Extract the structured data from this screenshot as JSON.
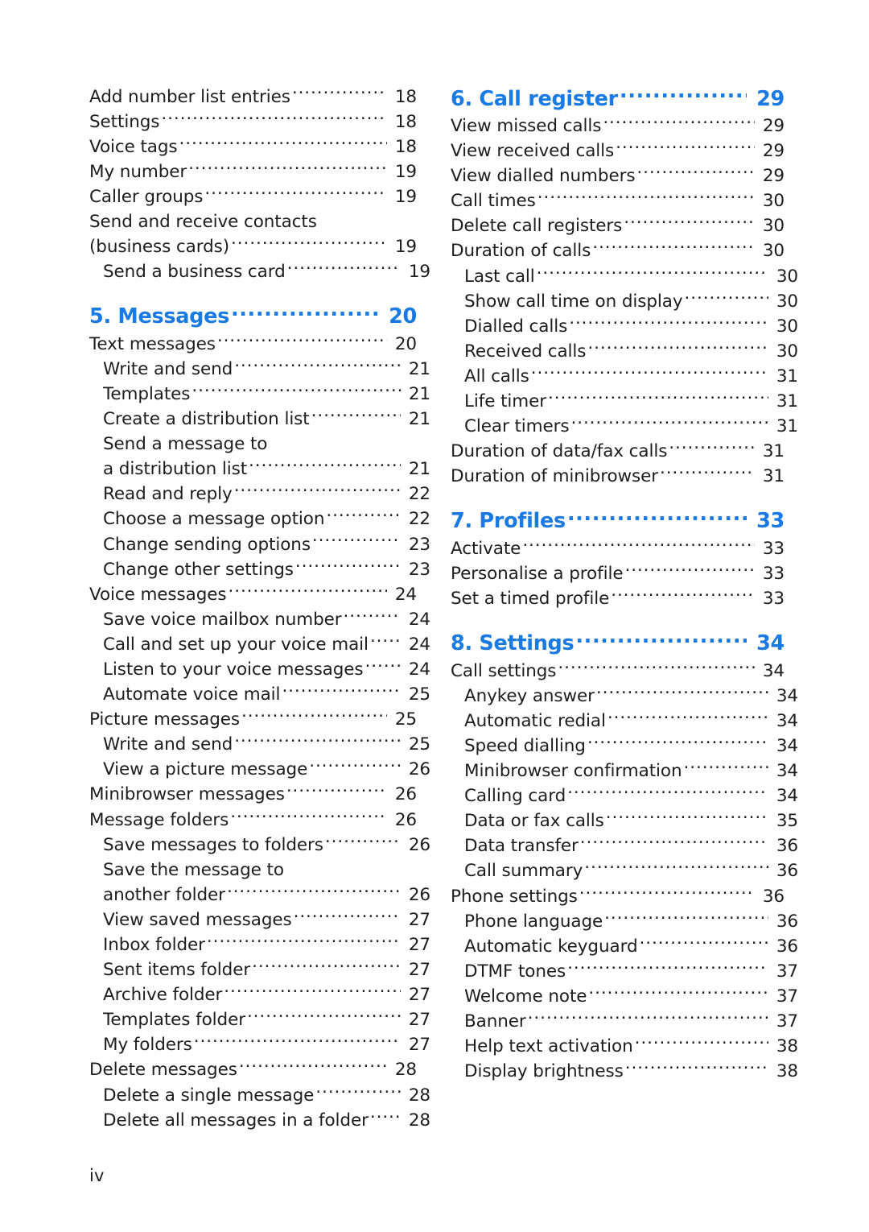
{
  "document": {
    "page_folio": "iv",
    "accent_color": "#1a7ae4",
    "text_color": "#1d1d1b"
  },
  "left_column": [
    {
      "kind": "entry",
      "level": 1,
      "label": "Add number list entries",
      "page": "18"
    },
    {
      "kind": "entry",
      "level": 1,
      "label": "Settings",
      "page": "18"
    },
    {
      "kind": "entry",
      "level": 1,
      "label": "Voice tags",
      "page": "18"
    },
    {
      "kind": "entry",
      "level": 1,
      "label": "My number",
      "page": "19"
    },
    {
      "kind": "entry",
      "level": 1,
      "label": "Caller groups",
      "page": "19"
    },
    {
      "kind": "wrap",
      "level": 1,
      "label": "Send and receive contacts",
      "page": ""
    },
    {
      "kind": "entry",
      "level": 1,
      "label": "(business cards)",
      "page": "19"
    },
    {
      "kind": "entry",
      "level": 2,
      "label": "Send a business card",
      "page": "19"
    },
    {
      "kind": "section",
      "level": 1,
      "label": "5. Messages",
      "page": "20"
    },
    {
      "kind": "entry",
      "level": 1,
      "label": "Text messages",
      "page": "20"
    },
    {
      "kind": "entry",
      "level": 2,
      "label": "Write and send",
      "page": "21"
    },
    {
      "kind": "entry",
      "level": 2,
      "label": "Templates",
      "page": "21"
    },
    {
      "kind": "entry",
      "level": 2,
      "label": "Create a distribution list",
      "page": "21"
    },
    {
      "kind": "wrap",
      "level": 2,
      "label": "Send a message to",
      "page": ""
    },
    {
      "kind": "entry",
      "level": 2,
      "label": "a distribution list",
      "page": "21"
    },
    {
      "kind": "entry",
      "level": 2,
      "label": "Read and reply",
      "page": "22"
    },
    {
      "kind": "entry",
      "level": 2,
      "label": "Choose a message option",
      "page": "22"
    },
    {
      "kind": "entry",
      "level": 2,
      "label": "Change sending options",
      "page": "23"
    },
    {
      "kind": "entry",
      "level": 2,
      "label": "Change other settings",
      "page": "23"
    },
    {
      "kind": "entry",
      "level": 1,
      "label": "Voice messages",
      "page": "24"
    },
    {
      "kind": "entry",
      "level": 2,
      "label": "Save voice mailbox number",
      "page": "24"
    },
    {
      "kind": "entry",
      "level": 2,
      "label": "Call and set up your voice mail",
      "page": "24"
    },
    {
      "kind": "entry",
      "level": 2,
      "label": "Listen to your voice messages",
      "page": "24"
    },
    {
      "kind": "entry",
      "level": 2,
      "label": "Automate voice mail",
      "page": "25"
    },
    {
      "kind": "entry",
      "level": 1,
      "label": "Picture messages",
      "page": "25"
    },
    {
      "kind": "entry",
      "level": 2,
      "label": "Write and send",
      "page": "25"
    },
    {
      "kind": "entry",
      "level": 2,
      "label": "View a picture message",
      "page": "26"
    },
    {
      "kind": "entry",
      "level": 1,
      "label": "Minibrowser messages",
      "page": "26"
    },
    {
      "kind": "entry",
      "level": 1,
      "label": "Message folders",
      "page": "26"
    },
    {
      "kind": "entry",
      "level": 2,
      "label": "Save messages to folders",
      "page": "26"
    },
    {
      "kind": "wrap",
      "level": 2,
      "label": "Save the message to",
      "page": ""
    },
    {
      "kind": "entry",
      "level": 2,
      "label": "another folder",
      "page": "26"
    },
    {
      "kind": "entry",
      "level": 2,
      "label": "View saved messages",
      "page": "27"
    },
    {
      "kind": "entry",
      "level": 2,
      "label": "Inbox folder",
      "page": "27"
    },
    {
      "kind": "entry",
      "level": 2,
      "label": "Sent items folder",
      "page": "27"
    },
    {
      "kind": "entry",
      "level": 2,
      "label": "Archive folder",
      "page": "27"
    },
    {
      "kind": "entry",
      "level": 2,
      "label": "Templates folder",
      "page": "27"
    },
    {
      "kind": "entry",
      "level": 2,
      "label": "My folders",
      "page": "27"
    },
    {
      "kind": "entry",
      "level": 1,
      "label": "Delete messages",
      "page": "28"
    },
    {
      "kind": "entry",
      "level": 2,
      "label": "Delete a single message",
      "page": "28"
    },
    {
      "kind": "entry",
      "level": 2,
      "label": "Delete all messages in a folder",
      "page": "28"
    }
  ],
  "right_column": [
    {
      "kind": "section",
      "level": 1,
      "label": "6. Call register",
      "page": "29",
      "first": true
    },
    {
      "kind": "entry",
      "level": 1,
      "label": "View missed calls",
      "page": "29"
    },
    {
      "kind": "entry",
      "level": 1,
      "label": "View received calls",
      "page": "29"
    },
    {
      "kind": "entry",
      "level": 1,
      "label": "View dialled numbers",
      "page": "29"
    },
    {
      "kind": "entry",
      "level": 1,
      "label": "Call times",
      "page": "30"
    },
    {
      "kind": "entry",
      "level": 1,
      "label": "Delete call registers",
      "page": "30"
    },
    {
      "kind": "entry",
      "level": 1,
      "label": "Duration of calls",
      "page": "30"
    },
    {
      "kind": "entry",
      "level": 2,
      "label": "Last call",
      "page": "30"
    },
    {
      "kind": "entry",
      "level": 2,
      "label": "Show call time on display",
      "page": "30"
    },
    {
      "kind": "entry",
      "level": 2,
      "label": "Dialled calls",
      "page": "30"
    },
    {
      "kind": "entry",
      "level": 2,
      "label": "Received calls",
      "page": "30"
    },
    {
      "kind": "entry",
      "level": 2,
      "label": "All calls",
      "page": "31"
    },
    {
      "kind": "entry",
      "level": 2,
      "label": "Life timer",
      "page": "31"
    },
    {
      "kind": "entry",
      "level": 2,
      "label": "Clear timers",
      "page": "31"
    },
    {
      "kind": "entry",
      "level": 1,
      "label": "Duration of data/fax calls",
      "page": "31"
    },
    {
      "kind": "entry",
      "level": 1,
      "label": "Duration of minibrowser",
      "page": "31"
    },
    {
      "kind": "section",
      "level": 1,
      "label": "7. Profiles",
      "page": "33"
    },
    {
      "kind": "entry",
      "level": 1,
      "label": "Activate",
      "page": "33"
    },
    {
      "kind": "entry",
      "level": 1,
      "label": "Personalise a profile",
      "page": "33"
    },
    {
      "kind": "entry",
      "level": 1,
      "label": "Set a timed profile",
      "page": "33"
    },
    {
      "kind": "section",
      "level": 1,
      "label": "8. Settings",
      "page": "34"
    },
    {
      "kind": "entry",
      "level": 1,
      "label": "Call settings",
      "page": "34"
    },
    {
      "kind": "entry",
      "level": 2,
      "label": "Anykey answer",
      "page": "34"
    },
    {
      "kind": "entry",
      "level": 2,
      "label": "Automatic redial",
      "page": "34"
    },
    {
      "kind": "entry",
      "level": 2,
      "label": "Speed dialling",
      "page": "34"
    },
    {
      "kind": "entry",
      "level": 2,
      "label": "Minibrowser confirmation",
      "page": "34"
    },
    {
      "kind": "entry",
      "level": 2,
      "label": "Calling card",
      "page": "34"
    },
    {
      "kind": "entry",
      "level": 2,
      "label": "Data or fax calls",
      "page": "35"
    },
    {
      "kind": "entry",
      "level": 2,
      "label": "Data transfer",
      "page": "36"
    },
    {
      "kind": "entry",
      "level": 2,
      "label": "Call summary",
      "page": "36"
    },
    {
      "kind": "entry",
      "level": 1,
      "label": "Phone settings",
      "page": "36"
    },
    {
      "kind": "entry",
      "level": 2,
      "label": "Phone language",
      "page": "36"
    },
    {
      "kind": "entry",
      "level": 2,
      "label": "Automatic keyguard",
      "page": "36"
    },
    {
      "kind": "entry",
      "level": 2,
      "label": "DTMF tones",
      "page": "37"
    },
    {
      "kind": "entry",
      "level": 2,
      "label": "Welcome note",
      "page": "37"
    },
    {
      "kind": "entry",
      "level": 2,
      "label": "Banner",
      "page": "37"
    },
    {
      "kind": "entry",
      "level": 2,
      "label": "Help text activation",
      "page": "38"
    },
    {
      "kind": "entry",
      "level": 2,
      "label": "Display brightness",
      "page": "38"
    }
  ]
}
